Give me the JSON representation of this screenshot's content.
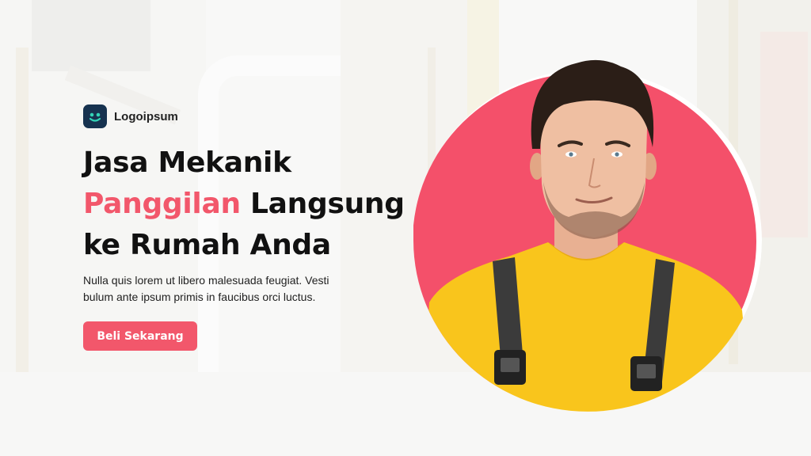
{
  "brand": {
    "name": "Logoipsum"
  },
  "hero": {
    "headline_line1": "Jasa Mekanik",
    "headline_accent": "Panggilan",
    "headline_line2_rest": " Langsung",
    "headline_line3": "ke Rumah Anda",
    "description": "Nulla quis lorem ut libero malesuada feugiat. Vesti bulum ante ipsum primis in faucibus orci luctus.",
    "cta_label": "Beli Sekarang"
  },
  "colors": {
    "accent": "#f2576b",
    "logo_mark": "#16324f",
    "text": "#111111",
    "shirt": "#f9c51c"
  }
}
